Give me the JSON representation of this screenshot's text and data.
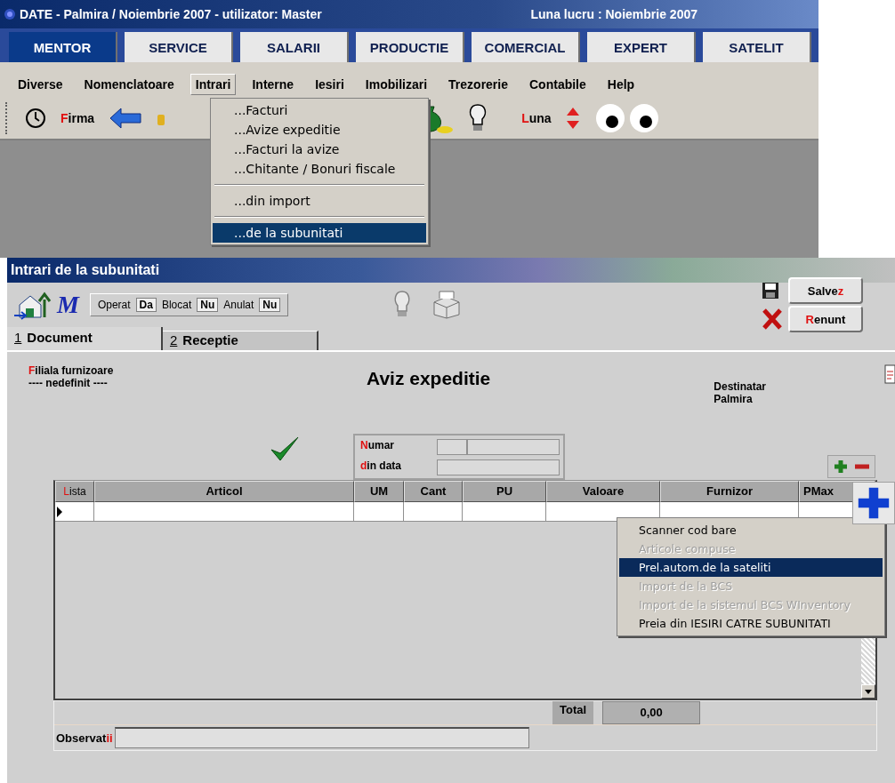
{
  "main_window": {
    "title": "DATE - Palmira / Noiembrie 2007 - utilizator: Master",
    "work_month": "Luna lucru : Noiembrie 2007",
    "modules": [
      {
        "label": "MENTOR",
        "selected": true
      },
      {
        "label": "SERVICE",
        "selected": false
      },
      {
        "label": "SALARII",
        "selected": false
      },
      {
        "label": "PRODUCTIE",
        "selected": false
      },
      {
        "label": "COMERCIAL",
        "selected": false
      },
      {
        "label": "EXPERT",
        "selected": false
      },
      {
        "label": "SATELIT",
        "selected": false
      }
    ],
    "menu_bar": [
      {
        "label": "Diverse",
        "selected": false
      },
      {
        "label": "Nomenclatoare",
        "selected": false
      },
      {
        "label": "Intrari",
        "selected": true
      },
      {
        "label": "Interne",
        "selected": false
      },
      {
        "label": "Iesiri",
        "selected": false
      },
      {
        "label": "Imobilizari",
        "selected": false
      },
      {
        "label": "Trezorerie",
        "selected": false
      },
      {
        "label": "Contabile",
        "selected": false
      },
      {
        "label": "Help",
        "selected": false
      }
    ],
    "firma_button": [
      {
        "text": "F",
        "accent": true
      },
      {
        "text": "irma",
        "accent": false
      }
    ],
    "luna_button": [
      {
        "text": "L",
        "accent": true
      },
      {
        "text": "una",
        "accent": false
      }
    ],
    "dropdown": [
      {
        "kind": "item",
        "label": "...Facturi",
        "selected": false
      },
      {
        "kind": "item",
        "label": "...Avize expeditie",
        "selected": false
      },
      {
        "kind": "item",
        "label": "...Facturi la avize",
        "selected": false
      },
      {
        "kind": "item",
        "label": "...Chitante / Bonuri fiscale",
        "selected": false
      },
      {
        "kind": "separator"
      },
      {
        "kind": "item",
        "label": "...din import",
        "selected": false
      },
      {
        "kind": "separator"
      },
      {
        "kind": "item",
        "label": "...de la subunitati",
        "selected": true
      }
    ]
  },
  "document_window": {
    "title": "Intrari de la subunitati",
    "logo": "M",
    "flags": [
      {
        "label": "Operat",
        "value": "Da"
      },
      {
        "label": "Blocat",
        "value": "Nu"
      },
      {
        "label": "Anulat",
        "value": "Nu"
      }
    ],
    "save_button": [
      {
        "text": "Salve",
        "accent": false
      },
      {
        "text": "z",
        "accent": true
      }
    ],
    "cancel_button": [
      {
        "text": "R",
        "accent": true
      },
      {
        "text": "enunt",
        "accent": false
      }
    ],
    "tabs": [
      {
        "key": "1",
        "label": "Document",
        "selected": true
      },
      {
        "key": "2",
        "label": "Receptie",
        "selected": false
      }
    ],
    "branch_label": [
      {
        "text": "F",
        "accent": true
      },
      {
        "text": "iliala furnizoare",
        "accent": false
      }
    ],
    "branch_value": "---- nedefinit ----",
    "heading": "Aviz expeditie",
    "recipient_label": "Destinatar",
    "recipient_value": "Palmira",
    "number_label": [
      {
        "text": "N",
        "accent": true
      },
      {
        "text": "umar",
        "accent": false
      }
    ],
    "date_label": [
      {
        "text": "d",
        "accent": true
      },
      {
        "text": "in data",
        "accent": false
      }
    ],
    "table": {
      "columns": [
        {
          "parts": [
            {
              "text": "L",
              "accent": true
            },
            {
              "text": "ista",
              "accent": false
            }
          ]
        },
        {
          "parts": [
            {
              "text": "Articol",
              "accent": false
            }
          ]
        },
        {
          "parts": [
            {
              "text": "UM",
              "accent": false
            }
          ]
        },
        {
          "parts": [
            {
              "text": "Cant",
              "accent": false
            }
          ]
        },
        {
          "parts": [
            {
              "text": "PU",
              "accent": false
            }
          ]
        },
        {
          "parts": [
            {
              "text": "Valoare",
              "accent": false
            }
          ]
        },
        {
          "parts": [
            {
              "text": "Furnizor",
              "accent": false
            }
          ]
        },
        {
          "parts": [
            {
              "text": "PMax",
              "accent": false
            }
          ]
        }
      ]
    },
    "total_label": "Total",
    "total_value": "0,00",
    "notes_label": [
      {
        "text": "Observat",
        "accent": false
      },
      {
        "text": "ii",
        "accent": true
      }
    ],
    "context_menu": [
      {
        "label": "Scanner cod bare",
        "disabled": false,
        "selected": false
      },
      {
        "label": "Articole compuse",
        "disabled": true,
        "selected": false
      },
      {
        "label": "Prel.autom.de la sateliti",
        "disabled": false,
        "selected": true
      },
      {
        "label": "Import de la BCS",
        "disabled": true,
        "selected": false
      },
      {
        "label": "Import de la sistemul BCS WInventory",
        "disabled": true,
        "selected": false
      },
      {
        "label": "Preia din IESIRI CATRE SUBUNITATI",
        "disabled": false,
        "selected": false
      }
    ]
  }
}
